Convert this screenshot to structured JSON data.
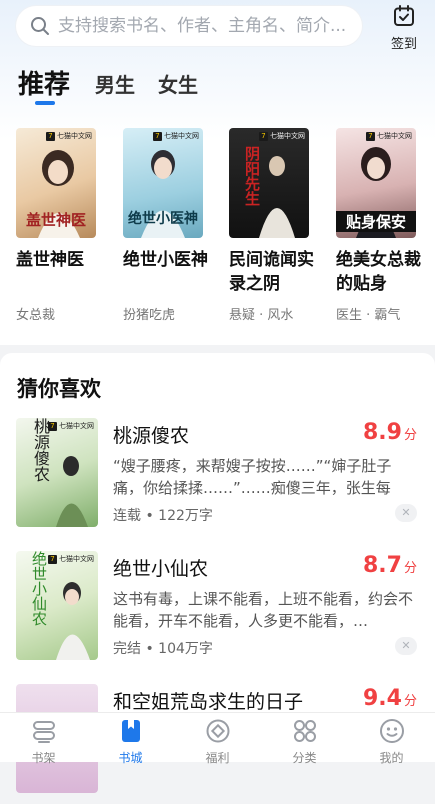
{
  "search": {
    "placeholder": "支持搜索书名、作者、主角名、简介..."
  },
  "checkin": {
    "label": "签到"
  },
  "tabs": [
    {
      "label": "推荐"
    },
    {
      "label": "男生"
    },
    {
      "label": "女生"
    }
  ],
  "publisher": "七猫中文网",
  "recommend": [
    {
      "title": "盖世神医",
      "tag": "女总裁",
      "cover_text": "盖世神医"
    },
    {
      "title": "绝世小医神",
      "tag": "扮猪吃虎",
      "cover_text": "绝世小医神"
    },
    {
      "title": "民间诡闻实录之阴",
      "tag": "悬疑 · 风水",
      "cover_text": "阴阳先生"
    },
    {
      "title": "绝美女总裁的贴身",
      "tag": "医生 · 霸气",
      "cover_text": "贴身保安"
    }
  ],
  "guess": {
    "title": "猜你喜欢",
    "score_unit": "分",
    "items": [
      {
        "title": "桃源傻农",
        "score": "8.9",
        "desc": "“嫂子腰疼，来帮嫂子按按……”“婶子肚子痛，你给揉揉……”……痴傻三年，张生每天…",
        "meta": "连载 • 122万字",
        "cover_text": "桃源傻农"
      },
      {
        "title": "绝世小仙农",
        "score": "8.7",
        "desc": "这书有毒，上课不能看，上班不能看，约会不能看，开车不能看，人多更不能看，…",
        "meta": "完结 • 104万字",
        "cover_text": "绝世小仙农"
      },
      {
        "title": "和空姐荒岛求生的日子",
        "score": "9.4",
        "desc": "",
        "meta": "",
        "cover_text": ""
      }
    ]
  },
  "nav": [
    {
      "label": "书架",
      "icon": "bookshelf-icon"
    },
    {
      "label": "书城",
      "icon": "bookstore-icon"
    },
    {
      "label": "福利",
      "icon": "welfare-icon"
    },
    {
      "label": "分类",
      "icon": "category-icon"
    },
    {
      "label": "我的",
      "icon": "profile-icon"
    }
  ],
  "colors": {
    "accent": "#1e78ea",
    "score": "#f04142"
  }
}
